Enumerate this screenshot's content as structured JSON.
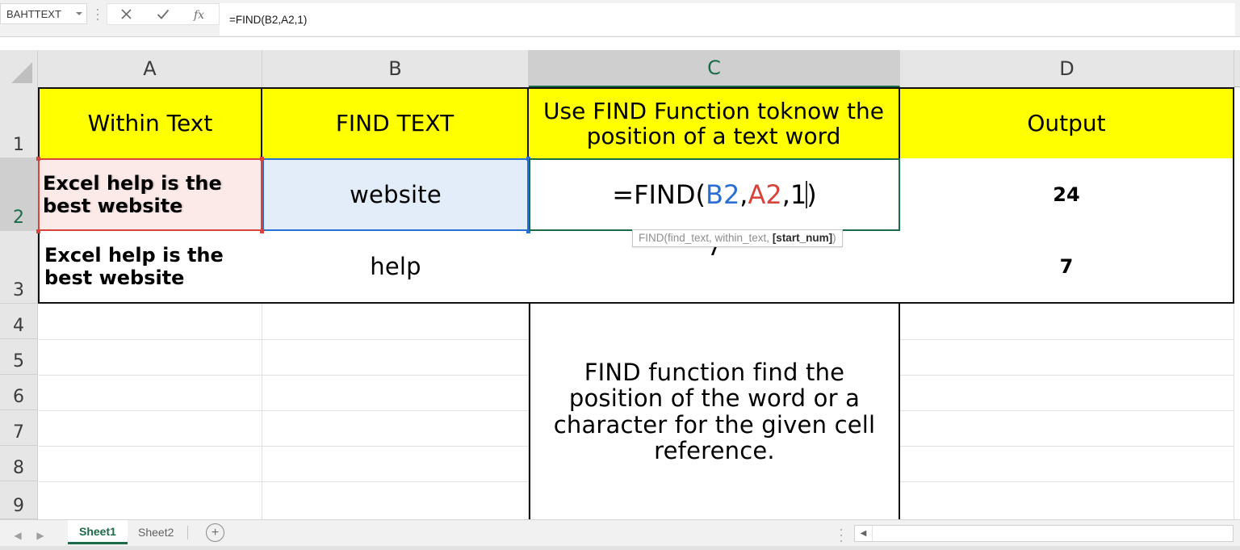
{
  "formula_bar": {
    "name_box_value": "BAHTTEXT",
    "name_box_dropdown_icon": "chevron-down-icon",
    "drag_handle_icon": "vertical-dots-icon",
    "cancel_icon": "close-icon",
    "enter_icon": "check-icon",
    "insert_function_icon": "fx-icon",
    "formula_value": "=FIND(B2,A2,1)"
  },
  "grid": {
    "select_all_icon": "select-all-corner-icon",
    "columns": [
      {
        "label": "A",
        "active": false
      },
      {
        "label": "B",
        "active": false
      },
      {
        "label": "C",
        "active": true
      },
      {
        "label": "D",
        "active": false
      }
    ],
    "rows": [
      {
        "label": "1",
        "active": false
      },
      {
        "label": "2",
        "active": true
      },
      {
        "label": "3",
        "active": false
      },
      {
        "label": "4",
        "active": false
      },
      {
        "label": "5",
        "active": false
      },
      {
        "label": "6",
        "active": false
      },
      {
        "label": "7",
        "active": false
      },
      {
        "label": "8",
        "active": false
      },
      {
        "label": "9",
        "active": false
      }
    ],
    "header_row": {
      "a": "Within Text",
      "b": "FIND TEXT",
      "c": "Use FIND Function toknow the position of a text word",
      "d": "Output",
      "fill_color": "#ffff00"
    },
    "row2": {
      "a": "Excel help is the best website",
      "b": "website",
      "d": "24"
    },
    "row3": {
      "a": "Excel help is the best website",
      "b": "help",
      "c": "7",
      "d": "7"
    },
    "note_cell": {
      "text": "FIND function find the position of the word or a character for the given cell reference."
    },
    "editing_cell": {
      "prefix": "=FIND(",
      "arg1": "B2",
      "comma1": ",",
      "arg2": "A2",
      "comma2": ",",
      "arg3": "1",
      "suffix": ")",
      "arg1_color": "#2a6fd4",
      "arg2_color": "#d8443c"
    },
    "tooltip": {
      "prefix": "FIND(find_text, within_text, ",
      "bold_part": "[start_num]",
      "suffix": ")"
    }
  },
  "sheetbar": {
    "prev_icon": "arrow-left-icon",
    "next_icon": "arrow-right-icon",
    "tabs": [
      {
        "label": "Sheet1",
        "active": true
      },
      {
        "label": "Sheet2",
        "active": false
      }
    ],
    "add_sheet_icon": "plus-circle-icon",
    "add_sheet_label": "+",
    "scroll_handle_icon": "vertical-dots-icon",
    "scroll_left_icon": "triangle-left-icon",
    "scroll_left_label": "◀"
  }
}
